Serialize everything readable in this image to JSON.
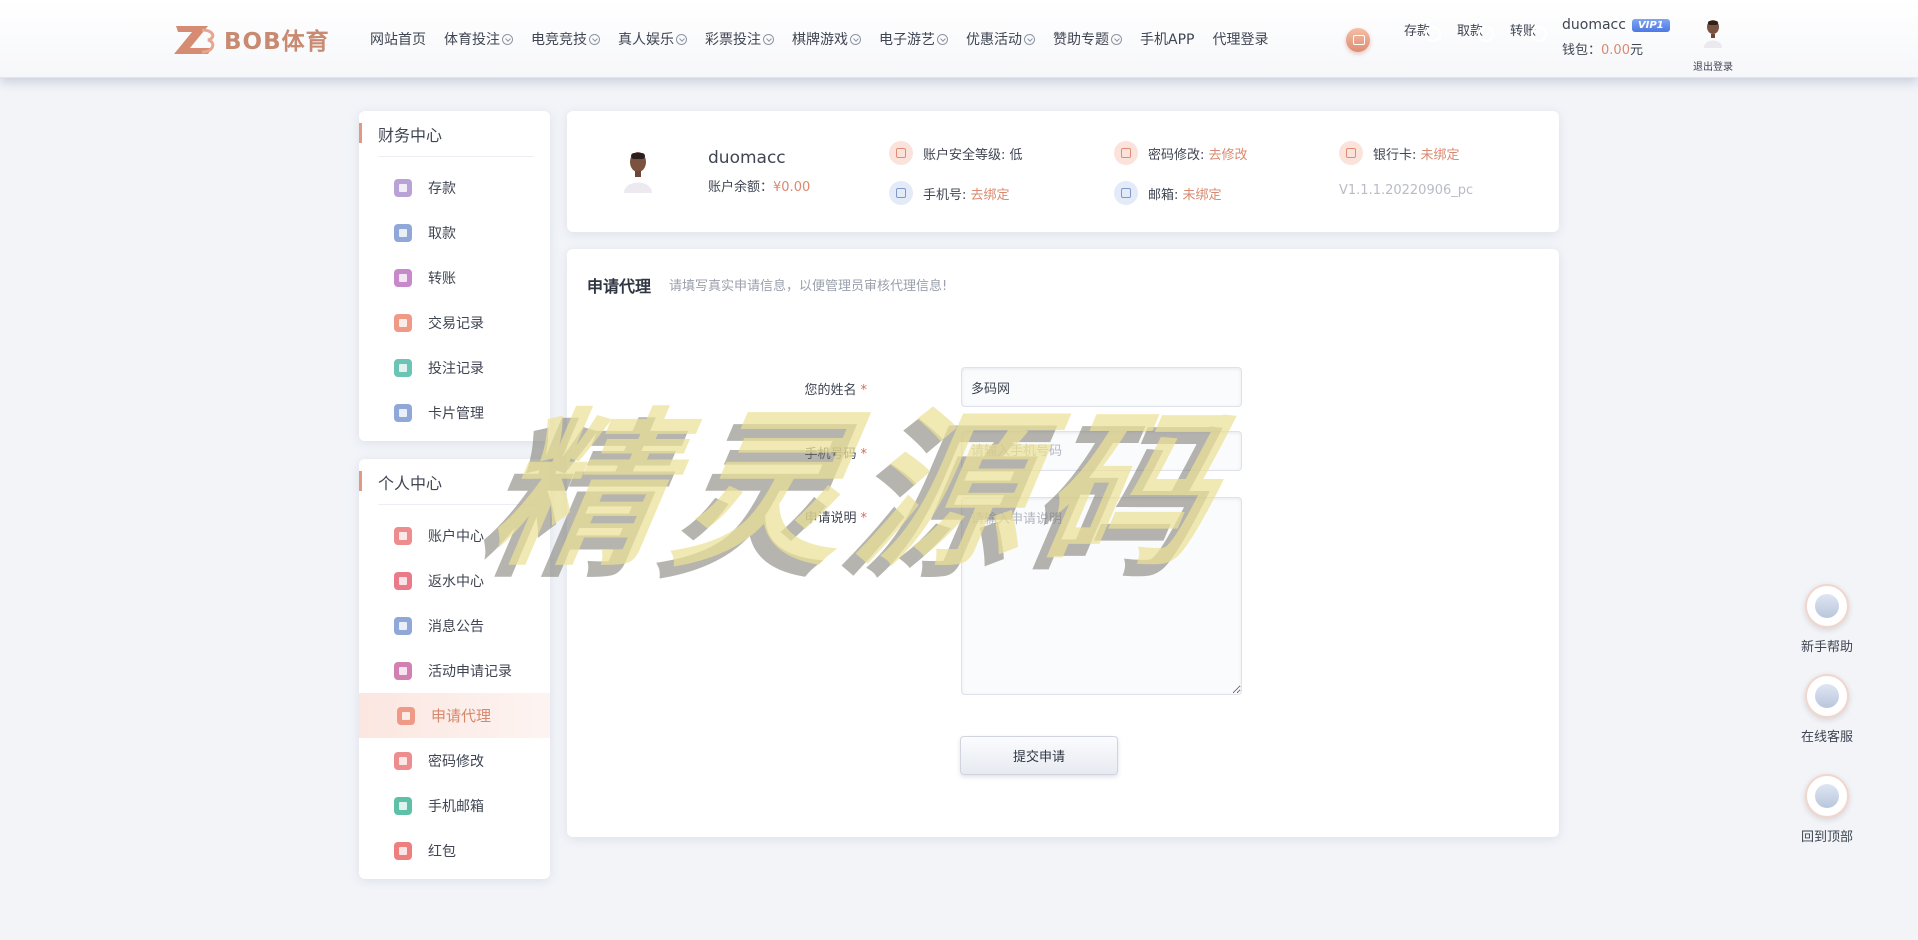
{
  "header": {
    "logo_text": "BOB体育",
    "nav": [
      {
        "label": "网站首页",
        "dropdown": false
      },
      {
        "label": "体育投注",
        "dropdown": true
      },
      {
        "label": "电竞竞技",
        "dropdown": true
      },
      {
        "label": "真人娱乐",
        "dropdown": true
      },
      {
        "label": "彩票投注",
        "dropdown": true
      },
      {
        "label": "棋牌游戏",
        "dropdown": true
      },
      {
        "label": "电子游艺",
        "dropdown": true
      },
      {
        "label": "优惠活动",
        "dropdown": true
      },
      {
        "label": "赞助专题",
        "dropdown": true
      },
      {
        "label": "手机APP",
        "dropdown": false
      },
      {
        "label": "代理登录",
        "dropdown": false
      }
    ],
    "actions": {
      "deposit": "存款",
      "withdraw": "取款",
      "transfer": "转账"
    },
    "username": "duomacc",
    "vip_badge": "VIP1",
    "wallet_label": "钱包：",
    "wallet_amount": "0.00",
    "wallet_unit": "元",
    "logout_label": "退出登录"
  },
  "sidebar": {
    "finance_title": "财务中心",
    "finance_items": [
      {
        "label": "存款",
        "icon": "deposit-icon",
        "color": "#b9a3d6"
      },
      {
        "label": "取款",
        "icon": "withdraw-icon",
        "color": "#8fa8d8"
      },
      {
        "label": "转账",
        "icon": "transfer-icon",
        "color": "#c789c9"
      },
      {
        "label": "交易记录",
        "icon": "transaction-record-icon",
        "color": "#ee9a86"
      },
      {
        "label": "投注记录",
        "icon": "bet-record-icon",
        "color": "#6cc4b4"
      },
      {
        "label": "卡片管理",
        "icon": "card-icon",
        "color": "#8fa8d8"
      }
    ],
    "personal_title": "个人中心",
    "personal_items": [
      {
        "label": "账户中心",
        "icon": "heart-icon",
        "color": "#ee8d8d",
        "active": false
      },
      {
        "label": "返水中心",
        "icon": "gift-icon",
        "color": "#ea7a8a",
        "active": false
      },
      {
        "label": "消息公告",
        "icon": "bell-icon",
        "color": "#8fa8d8",
        "active": false
      },
      {
        "label": "活动申请记录",
        "icon": "user-card-icon",
        "color": "#d27fb2",
        "active": false
      },
      {
        "label": "申请代理",
        "icon": "agent-icon",
        "color": "#ee9a86",
        "active": true
      },
      {
        "label": "密码修改",
        "icon": "lock-icon",
        "color": "#ee8d8d",
        "active": false
      },
      {
        "label": "手机邮箱",
        "icon": "mail-icon",
        "color": "#5fc0a8",
        "active": false
      },
      {
        "label": "红包",
        "icon": "red-packet-icon",
        "color": "#ee7f7f",
        "active": false
      }
    ]
  },
  "profile": {
    "username": "duomacc",
    "balance_label": "账户余额：",
    "balance_value": "¥0.00",
    "security_label": "账户安全等级:",
    "security_value": "低",
    "password_label": "密码修改:",
    "password_value": "去修改",
    "bankcard_label": "银行卡:",
    "bankcard_value": "未绑定",
    "phone_label": "手机号:",
    "phone_value": "去绑定",
    "email_label": "邮箱:",
    "email_value": "未绑定",
    "version": "V1.1.1.20220906_pc"
  },
  "form": {
    "title": "申请代理",
    "hint": "请填写真实申请信息，以便管理员审核代理信息!",
    "name_label": "您的姓名",
    "name_value": "多码网",
    "phone_label": "手机号码",
    "phone_placeholder": "请输入手机号码",
    "desc_label": "申请说明",
    "desc_placeholder": "请输入申请说明",
    "required_mark": "*",
    "submit_label": "提交申请"
  },
  "float_widgets": {
    "help": "新手帮助",
    "service": "在线客服",
    "top": "回到顶部"
  },
  "watermark": "精灵源码"
}
